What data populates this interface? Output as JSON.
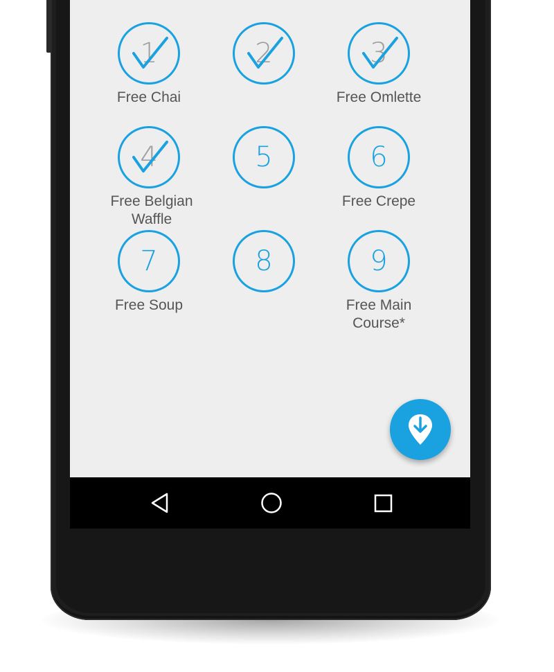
{
  "stamps": [
    {
      "number": "1",
      "reward": "Free Chai",
      "checked": true
    },
    {
      "number": "2",
      "reward": "",
      "checked": true
    },
    {
      "number": "3",
      "reward": "Free Omlette",
      "checked": true
    },
    {
      "number": "4",
      "reward": "Free Belgian Waffle",
      "checked": true
    },
    {
      "number": "5",
      "reward": "",
      "checked": false
    },
    {
      "number": "6",
      "reward": "Free Crepe",
      "checked": false
    },
    {
      "number": "7",
      "reward": "Free Soup",
      "checked": false
    },
    {
      "number": "8",
      "reward": "",
      "checked": false
    },
    {
      "number": "9",
      "reward": "Free Main Course*",
      "checked": false
    }
  ],
  "fab": {
    "icon": "download-pin-icon"
  },
  "navbar": {
    "back_icon": "back-triangle-icon",
    "home_icon": "home-circle-icon",
    "recents_icon": "recents-square-icon"
  },
  "colors": {
    "accent": "#19a1e0",
    "screen_bg": "#eeeeee",
    "label_text": "#555555",
    "nav_bg": "#000000"
  }
}
